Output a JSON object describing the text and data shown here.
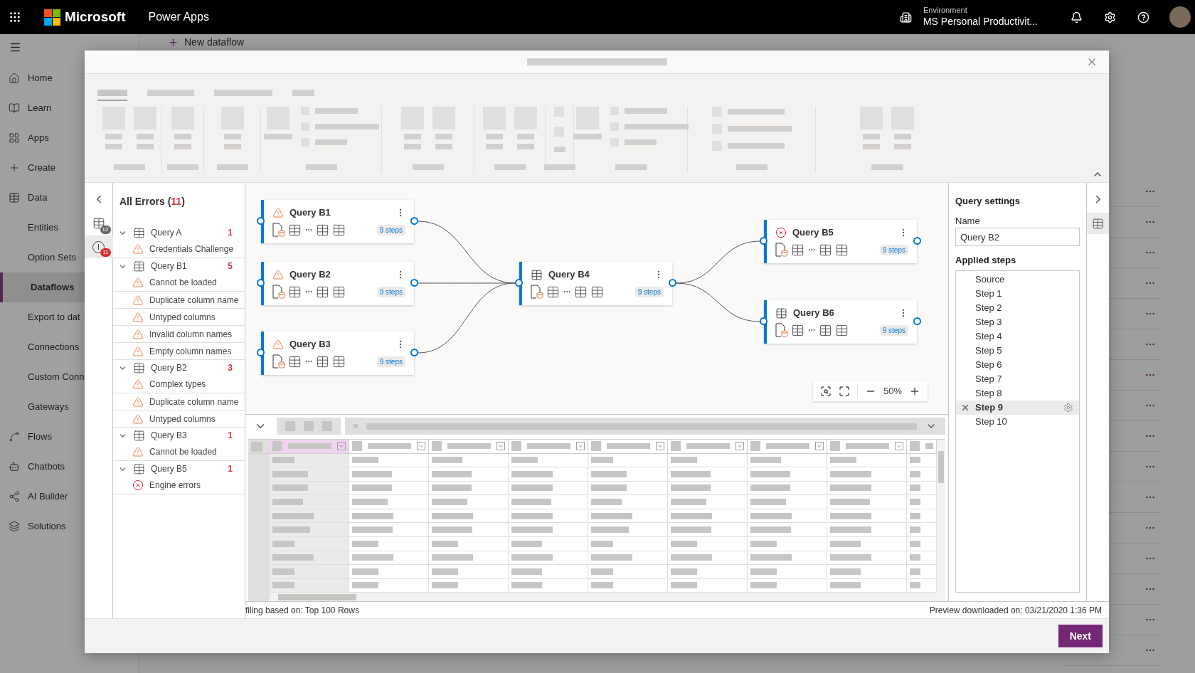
{
  "top_bar": {
    "brand": "Microsoft",
    "app": "Power Apps",
    "environment_label": "Environment",
    "environment": "MS Personal Productivit..."
  },
  "nav": [
    {
      "label": "Home",
      "selected": false
    },
    {
      "label": "Learn",
      "selected": false
    },
    {
      "label": "Apps",
      "selected": false
    },
    {
      "label": "Create",
      "selected": false
    },
    {
      "label": "Data",
      "selected": false
    },
    {
      "label": "Entities",
      "selected": false
    },
    {
      "label": "Option Sets",
      "selected": false
    },
    {
      "label": "Dataflows",
      "selected": true
    },
    {
      "label": "Export to dat",
      "selected": false
    },
    {
      "label": "Connections",
      "selected": false
    },
    {
      "label": "Custom Conn",
      "selected": false
    },
    {
      "label": "Gateways",
      "selected": false
    },
    {
      "label": "Flows",
      "selected": false
    },
    {
      "label": "Chatbots",
      "selected": false
    },
    {
      "label": "AI Builder",
      "selected": false
    },
    {
      "label": "Solutions",
      "selected": false
    }
  ],
  "page": {
    "command": "New dataflow"
  },
  "dialog": {
    "rail": {
      "tables_badge": "12",
      "errors_badge": "11"
    },
    "errors": {
      "title": "All Errors (",
      "count": "11",
      "title_end": ")",
      "groups": [
        {
          "query": "Query A",
          "count": "1",
          "items": [
            {
              "label": "Credentials Challenge",
              "kind": "warning"
            }
          ]
        },
        {
          "query": "Query B1",
          "count": "5",
          "items": [
            {
              "label": "Cannot be loaded",
              "kind": "warning"
            },
            {
              "label": "Duplicate column name",
              "kind": "warning"
            },
            {
              "label": "Untyped columns",
              "kind": "warning"
            },
            {
              "label": "Invalid column names",
              "kind": "warning"
            },
            {
              "label": "Empty column names",
              "kind": "warning"
            }
          ]
        },
        {
          "query": "Query B2",
          "count": "3",
          "items": [
            {
              "label": "Complex types",
              "kind": "warning"
            },
            {
              "label": "Duplicate column name",
              "kind": "warning"
            },
            {
              "label": "Untyped columns",
              "kind": "warning"
            }
          ]
        },
        {
          "query": "Query B3",
          "count": "1",
          "items": [
            {
              "label": "Cannot be loaded",
              "kind": "warning"
            }
          ]
        },
        {
          "query": "Query B5",
          "count": "1",
          "items": [
            {
              "label": "Engine errors",
              "kind": "error"
            }
          ]
        }
      ]
    },
    "nodes": [
      {
        "name": "Query B1",
        "kind": "warning",
        "steps": "9 steps"
      },
      {
        "name": "Query B2",
        "kind": "warning",
        "steps": "9 steps"
      },
      {
        "name": "Query B3",
        "kind": "warning",
        "steps": "9 steps"
      },
      {
        "name": "Query B4",
        "kind": "table",
        "steps": "9 steps"
      },
      {
        "name": "Query B5",
        "kind": "error",
        "steps": "9 steps"
      },
      {
        "name": "Query B6",
        "kind": "table",
        "steps": "9 steps"
      }
    ],
    "zoom": "50%",
    "settings": {
      "title": "Query settings",
      "name_label": "Name",
      "name_value": "Query B2",
      "steps_title": "Applied steps",
      "steps": [
        {
          "label": "Source",
          "selected": false
        },
        {
          "label": "Step 1",
          "selected": false
        },
        {
          "label": "Step 2",
          "selected": false
        },
        {
          "label": "Step 3",
          "selected": false
        },
        {
          "label": "Step 4",
          "selected": false
        },
        {
          "label": "Step 5",
          "selected": false
        },
        {
          "label": "Step 6",
          "selected": false
        },
        {
          "label": "Step 7",
          "selected": false
        },
        {
          "label": "Step 8",
          "selected": false
        },
        {
          "label": "Step 9",
          "selected": true
        },
        {
          "label": "Step 10",
          "selected": false
        }
      ]
    },
    "status_left": "filing based on: Top 100 Rows",
    "status_right": "Preview downloaded on: 03/21/2020 1:36 PM",
    "next": "Next"
  }
}
